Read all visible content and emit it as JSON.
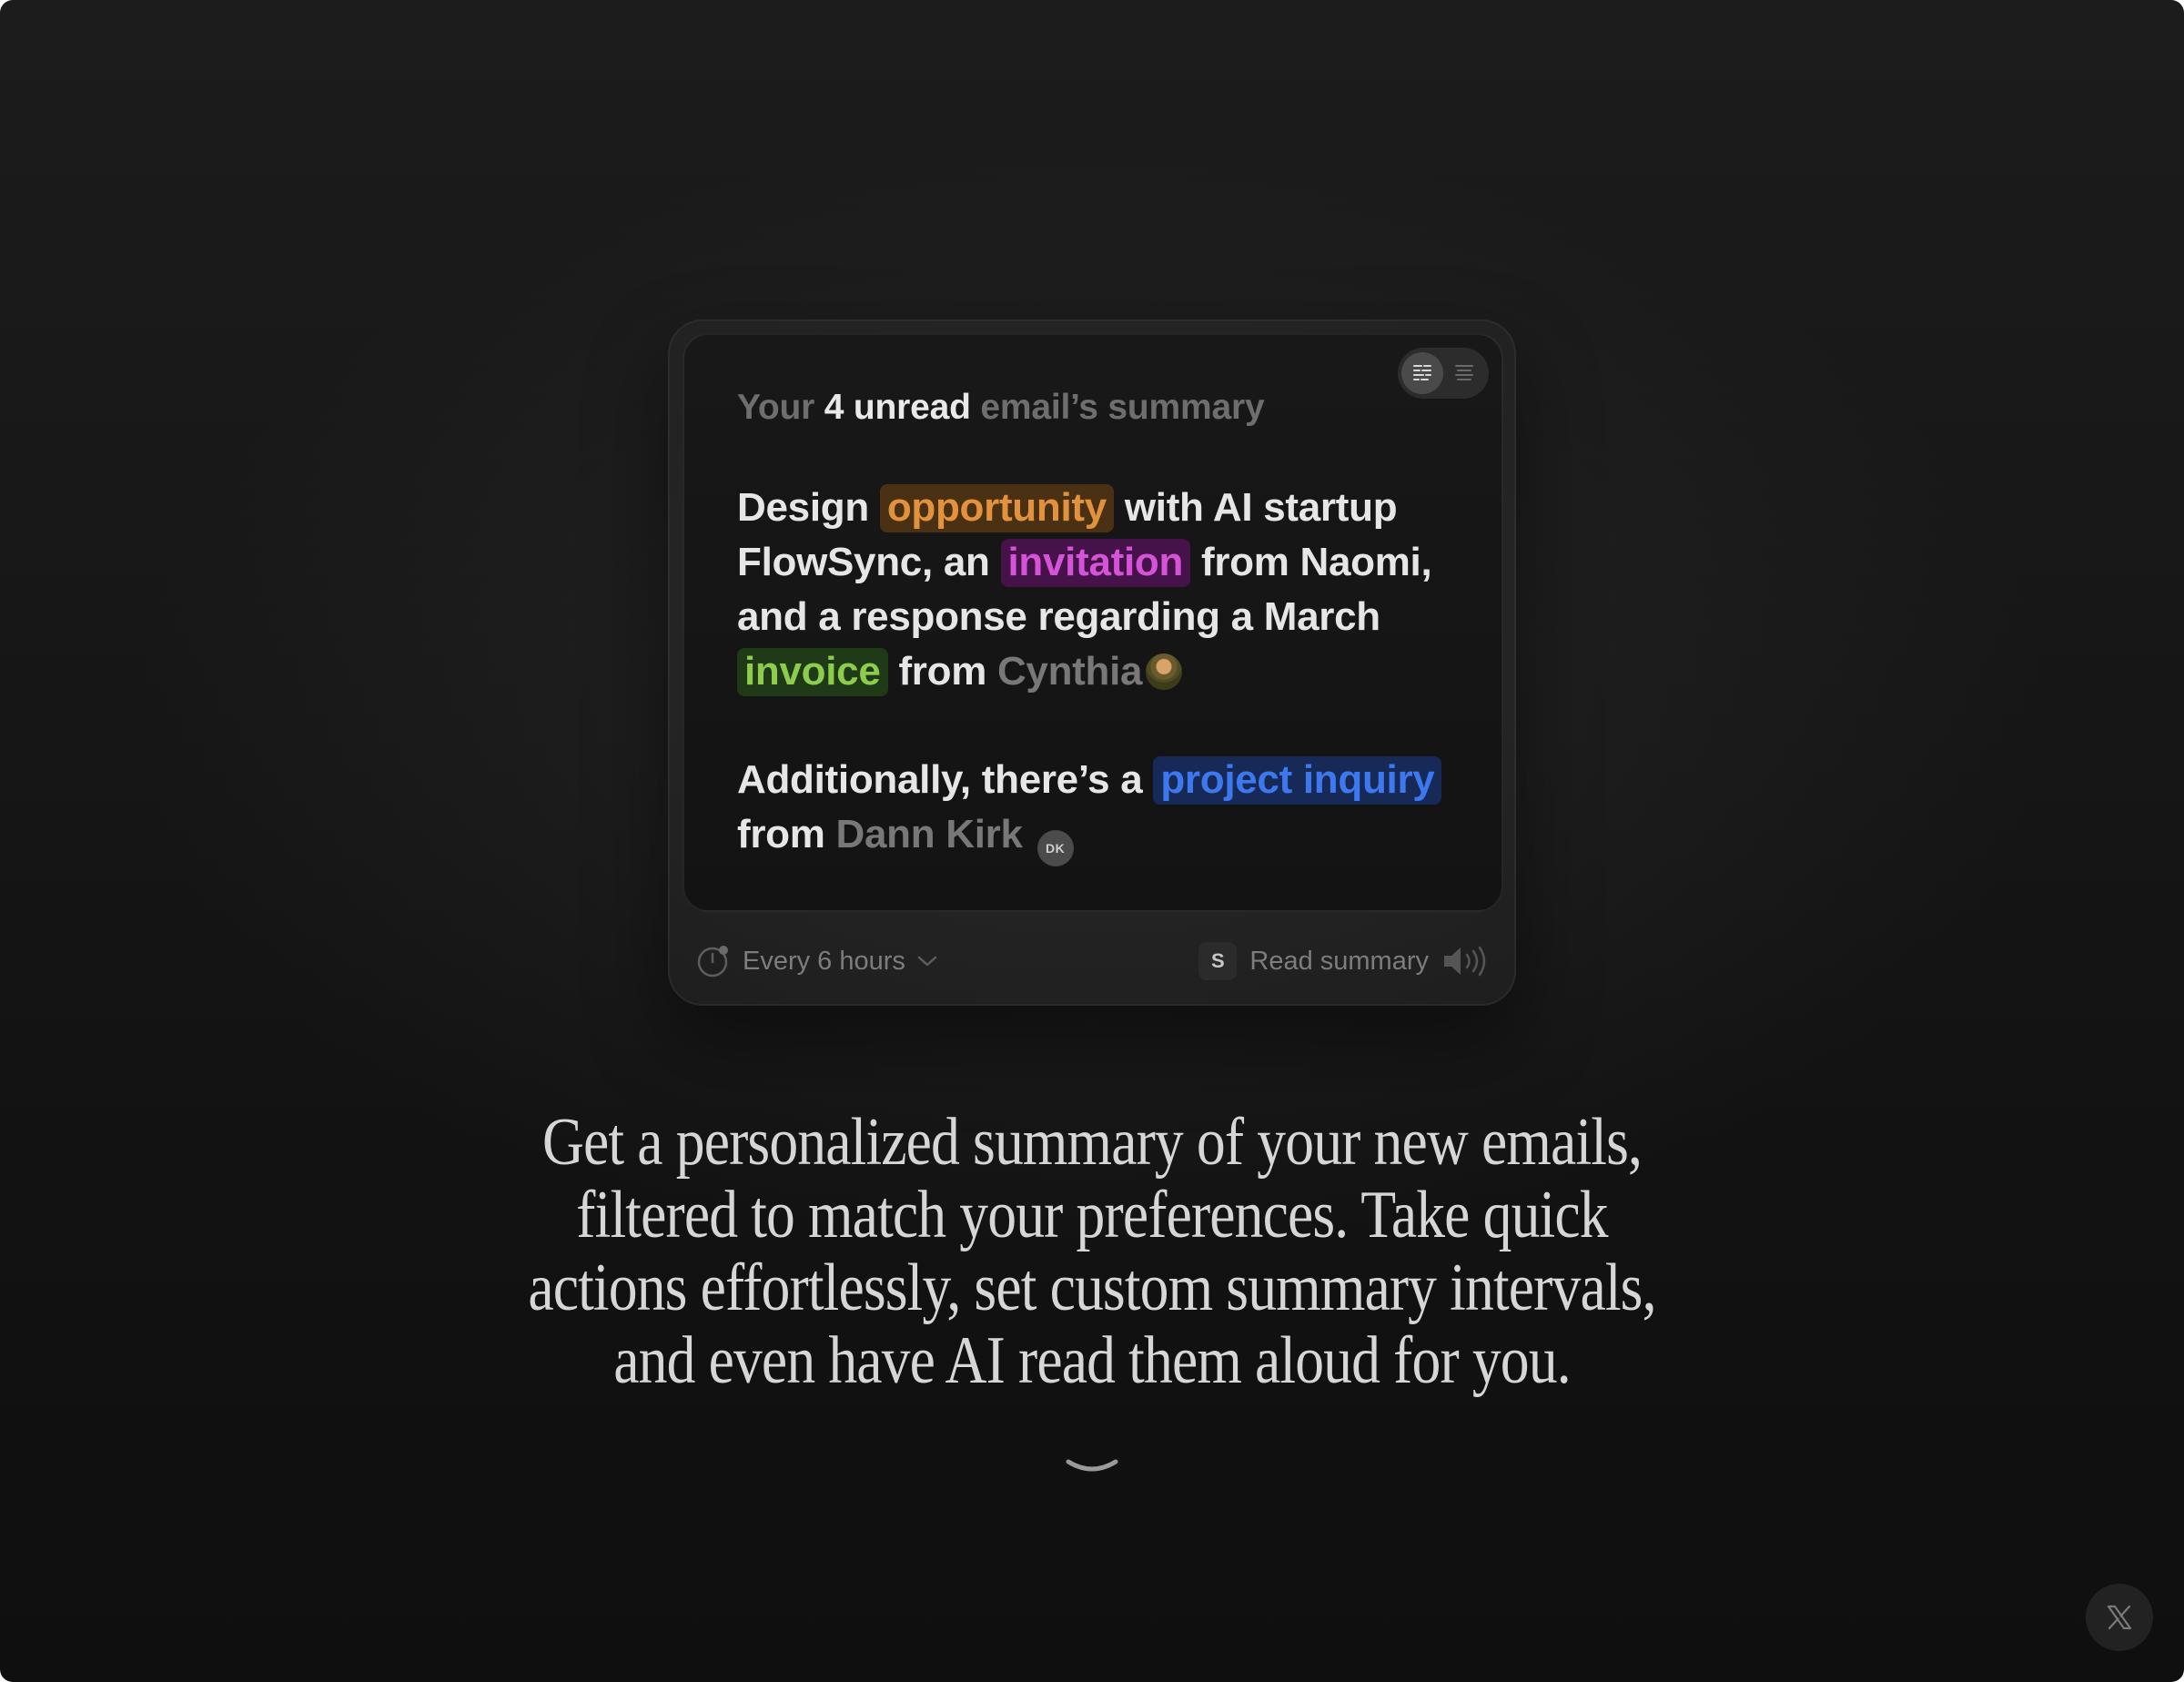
{
  "widget": {
    "view_toggle": {
      "options": [
        "detailed-view-icon",
        "compact-view-icon"
      ],
      "active": "detailed-view-icon"
    },
    "title": {
      "prefix": "Your",
      "count_text": "4 unread",
      "suffix": "email’s summary"
    },
    "summary": {
      "p1_seg1": "Design ",
      "opportunity": "opportunity",
      "p1_seg2": " with AI startup FlowSync, an ",
      "invitation": "invitation",
      "p1_seg3": " from Naomi, and a response regarding a March ",
      "invoice": "invoice",
      "p1_seg4": " from ",
      "cynthia": "Cynthia",
      "p2_seg1": "Additionally, there’s a ",
      "project_inquiry": "project inquiry",
      "p2_seg2": " from ",
      "dann_kirk": "Dann Kirk",
      "dann_initials": "DK"
    },
    "footer": {
      "interval_label": "Every 6 hours",
      "shortcut_key": "S",
      "read_label": "Read summary"
    }
  },
  "tagline": {
    "line1": "Get a personalized summary of your new emails,",
    "line2": "filtered to match your preferences. Take quick",
    "line3": "actions effortlessly, set custom summary intervals,",
    "line4": "and even have AI read them aloud for you."
  },
  "colors": {
    "opportunity": "#e2923c",
    "invitation": "#d453d7",
    "invoice": "#8dcc4d",
    "project_inquiry": "#3d78ef"
  },
  "icons": {
    "interval": "clock-icon",
    "dropdown": "chevron-down-icon",
    "speaker": "speaker-icon",
    "scroll": "scroll-down-chevron-icon",
    "social": "x-logo-icon"
  }
}
